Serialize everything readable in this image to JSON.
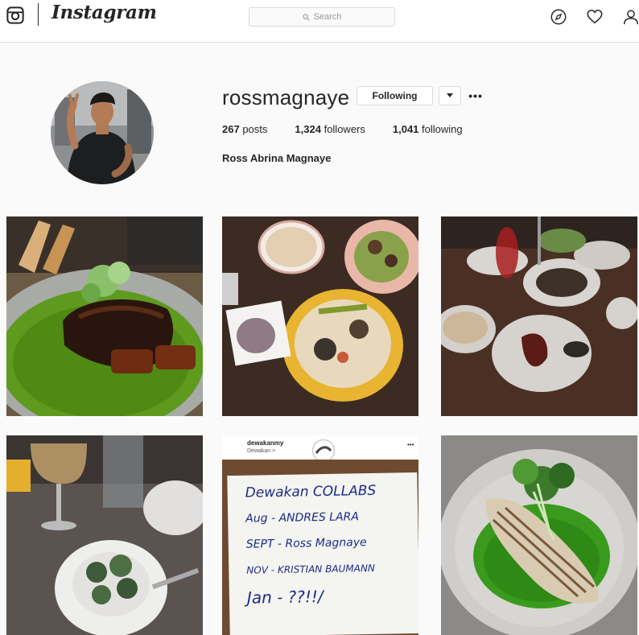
{
  "nav": {
    "brand": "Instagram",
    "search_placeholder": "Search",
    "icons": [
      "instagram-camera-icon",
      "compass-icon",
      "heart-icon",
      "person-icon"
    ]
  },
  "profile": {
    "username": "rossmagnaye",
    "follow_button": "Following",
    "more_label": "•••",
    "stats": {
      "posts_count": "267",
      "posts_label": "posts",
      "followers_count": "1,324",
      "followers_label": "followers",
      "following_count": "1,041",
      "following_label": "following"
    },
    "full_name": "Ross Abrina Magnaye"
  },
  "posts": [
    {
      "id": "post-1",
      "subject": "short-rib-plate"
    },
    {
      "id": "post-2",
      "subject": "hummus-spread"
    },
    {
      "id": "post-3",
      "subject": "dinner-table"
    },
    {
      "id": "post-4",
      "subject": "dumpling-bowl"
    },
    {
      "id": "post-5",
      "subject": "collab-sign",
      "embed_user": "dewakanmy",
      "embed_sub": "Dewakan >",
      "embed_more": "•••",
      "note_lines": [
        "Dewakan COLLABS",
        "Aug - ANDRES LARA",
        "SEPT - Ross Magnaye",
        "NOV - KRISTIAN BAUMANN",
        "Jan - ??!!/"
      ]
    },
    {
      "id": "post-6",
      "subject": "fish-with-herbs"
    }
  ],
  "colors": {
    "text": "#262626",
    "border": "#dbdbdb",
    "background": "#fafafa",
    "muted": "#999999"
  }
}
